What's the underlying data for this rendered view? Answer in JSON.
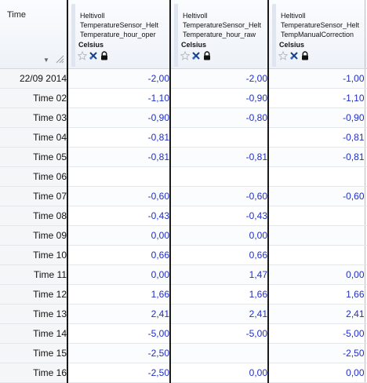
{
  "corner": {
    "label": "Time"
  },
  "columns": [
    {
      "lines": [
        "Heltivoll",
        "TemperatureSensor_Helt",
        "Temperature_hour_oper"
      ],
      "unit": "Celsius"
    },
    {
      "lines": [
        "Heltivoll",
        "TemperatureSensor_Helt",
        "Temperature_hour_raw"
      ],
      "unit": "Celsius"
    },
    {
      "lines": [
        "Heltivoll",
        "TemperatureSensor_Helt",
        "TempManualCorrection"
      ],
      "unit": "Celsius"
    }
  ],
  "header_icons": [
    "star-icon",
    "close-pin-icon",
    "lock-icon"
  ],
  "rows": [
    {
      "label": "22/09 2014",
      "values": [
        "-2,00",
        "-2,00",
        "-1,00"
      ]
    },
    {
      "label": "Time 02",
      "values": [
        "-1,10",
        "-0,90",
        "-1,10"
      ]
    },
    {
      "label": "Time 03",
      "values": [
        "-0,90",
        "-0,80",
        "-0,90"
      ]
    },
    {
      "label": "Time 04",
      "values": [
        "-0,81",
        "",
        "-0,81"
      ]
    },
    {
      "label": "Time 05",
      "values": [
        "-0,81",
        "-0,81",
        "-0,81"
      ]
    },
    {
      "label": "Time 06",
      "values": [
        "",
        "",
        ""
      ]
    },
    {
      "label": "Time 07",
      "values": [
        "-0,60",
        "-0,60",
        "-0,60"
      ]
    },
    {
      "label": "Time 08",
      "values": [
        "-0,43",
        "-0,43",
        ""
      ]
    },
    {
      "label": "Time 09",
      "values": [
        "0,00",
        "0,00",
        ""
      ]
    },
    {
      "label": "Time 10",
      "values": [
        "0,66",
        "0,66",
        ""
      ]
    },
    {
      "label": "Time 11",
      "values": [
        "0,00",
        "1,47",
        "0,00"
      ]
    },
    {
      "label": "Time 12",
      "values": [
        "1,66",
        "1,66",
        "1,66"
      ]
    },
    {
      "label": "Time 13",
      "values": [
        "2,41",
        "2,41",
        "2,41"
      ]
    },
    {
      "label": "Time 14",
      "values": [
        "-5,00",
        "-5,00",
        "-5,00"
      ]
    },
    {
      "label": "Time 15",
      "values": [
        "-2,50",
        "",
        "-2,50"
      ]
    },
    {
      "label": "Time 16",
      "values": [
        "-2,50",
        "0,00",
        "0,00"
      ]
    }
  ]
}
